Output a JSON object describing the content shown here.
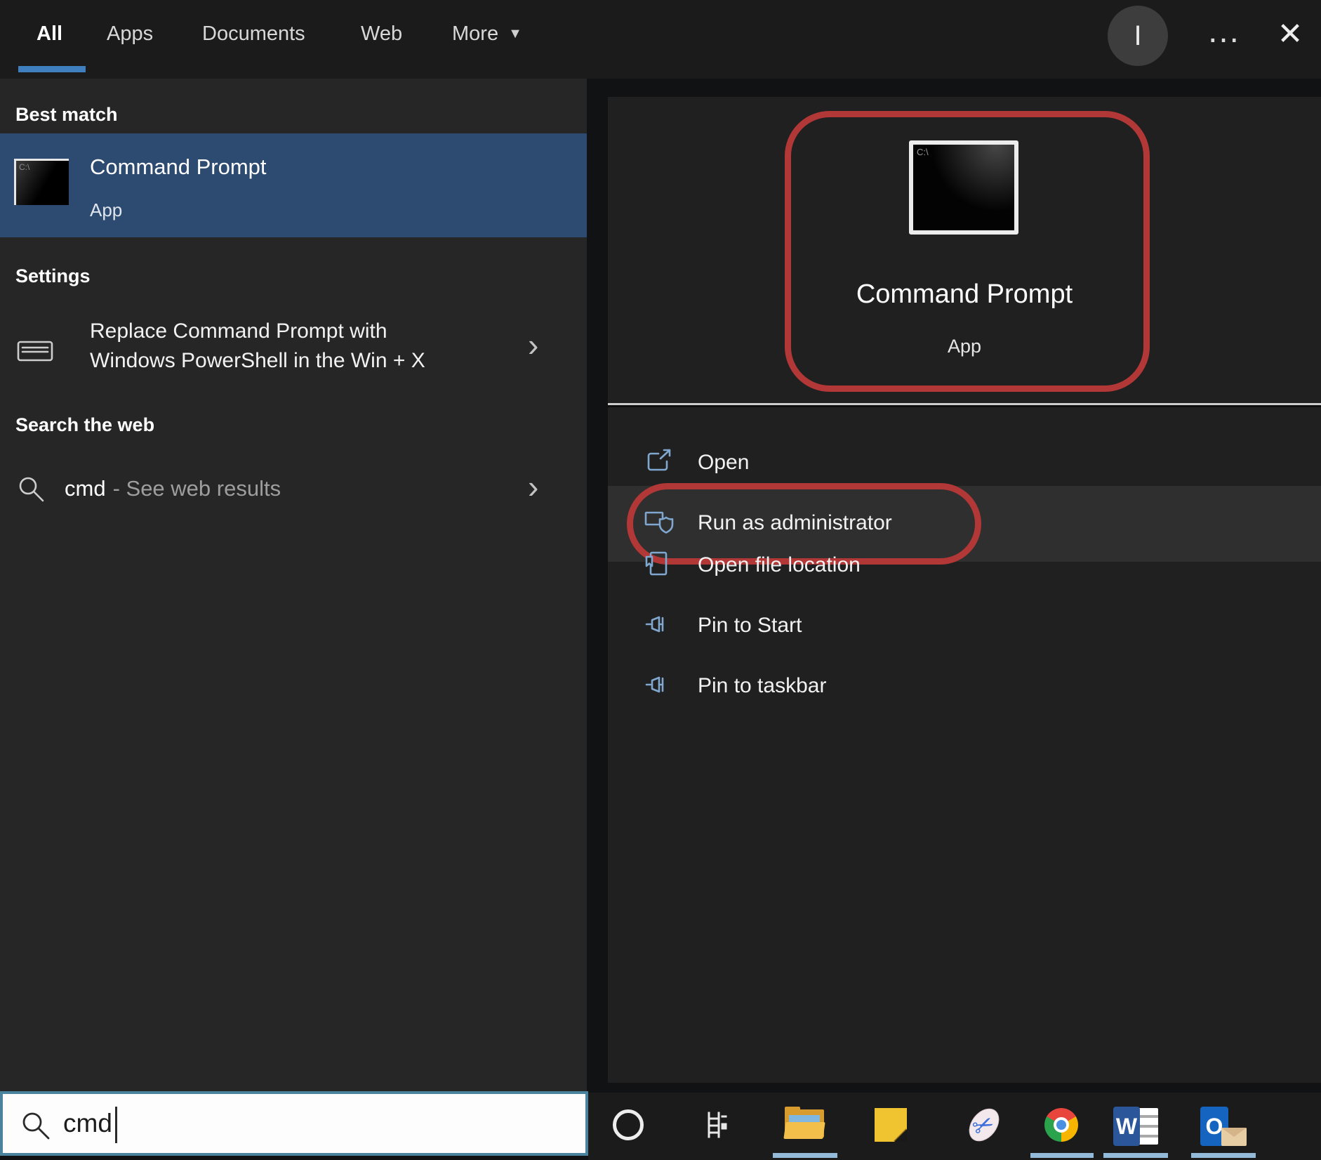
{
  "colors": {
    "highlight_row": "#2d4b70",
    "tab_underline": "#3f7fbe",
    "annotation_red": "#b23737",
    "taskbar_indicator": "#93bbd9"
  },
  "tabs": {
    "all": "All",
    "apps": "Apps",
    "documents": "Documents",
    "web": "Web",
    "more": "More"
  },
  "titlebar": {
    "avatar_initial": "I"
  },
  "icons": {
    "more_arrow": "▼",
    "ellipsis": "…",
    "close": "✕",
    "chevron": "›",
    "scissors": "✂",
    "cmd_prompt_text": "C:\\",
    "word_letter": "W",
    "outlook_letter": "O"
  },
  "left_panel": {
    "best_match_header": "Best match",
    "best_match_title": "Command Prompt",
    "best_match_subtitle": "App",
    "settings_header": "Settings",
    "settings_line1": "Replace Command Prompt with",
    "settings_line2": "Windows PowerShell in the Win + X",
    "web_header": "Search the web",
    "web_query": "cmd",
    "web_suffix": "- See web results"
  },
  "right_panel": {
    "app_title": "Command Prompt",
    "app_subtitle": "App",
    "actions": [
      {
        "label": "Open"
      },
      {
        "label": "Run as administrator"
      },
      {
        "label": "Open file location"
      },
      {
        "label": "Pin to Start"
      },
      {
        "label": "Pin to taskbar"
      }
    ]
  },
  "search_bar": {
    "value": "cmd"
  }
}
